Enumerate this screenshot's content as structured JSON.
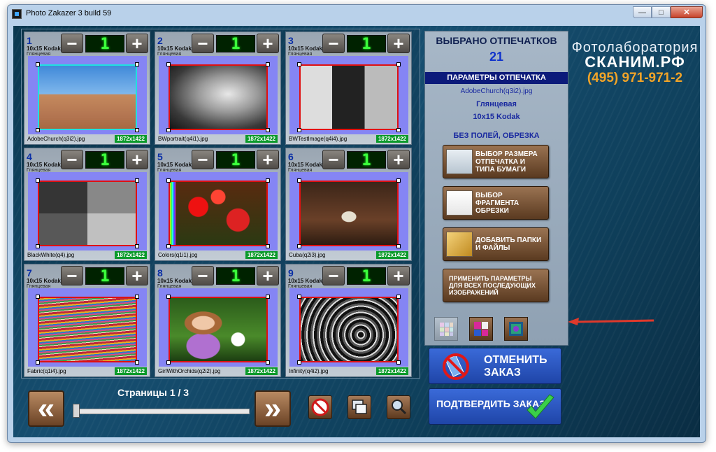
{
  "window": {
    "title": "Photo Zakazer 3 build 59",
    "min": "—",
    "max": "□",
    "close": "✕"
  },
  "brand": {
    "line1": "Фотолаборатория",
    "line2": "СКАНИМ.РФ",
    "phone": "(495) 971-971-2"
  },
  "tiles": [
    {
      "num": "1",
      "size": "10x15 Kodak",
      "paper": "Глянцевая",
      "count": "1",
      "file": "AdobeChurch(q3i2).jpg",
      "res": "1872x1422"
    },
    {
      "num": "2",
      "size": "10x15 Kodak",
      "paper": "Глянцевая",
      "count": "1",
      "file": "BWportrait(q4i1).jpg",
      "res": "1872x1422"
    },
    {
      "num": "3",
      "size": "10x15 Kodak",
      "paper": "Глянцевая",
      "count": "1",
      "file": "BWTestImage(q4i4).jpg",
      "res": "1872x1422"
    },
    {
      "num": "4",
      "size": "10x15 Kodak",
      "paper": "Глянцевая",
      "count": "1",
      "file": "BlackWhite(q4).jpg",
      "res": "1872x1422"
    },
    {
      "num": "5",
      "size": "10x15 Kodak",
      "paper": "Глянцевая",
      "count": "1",
      "file": "Colors(q1i1).jpg",
      "res": "1872x1422"
    },
    {
      "num": "6",
      "size": "10x15 Kodak",
      "paper": "Глянцевая",
      "count": "1",
      "file": "Cuba(q2i3).jpg",
      "res": "1872x1422"
    },
    {
      "num": "7",
      "size": "10x15 Kodak",
      "paper": "Глянцевая",
      "count": "1",
      "file": "Fabric(q1i4).jpg",
      "res": "1872x1422"
    },
    {
      "num": "8",
      "size": "10x15 Kodak",
      "paper": "Глянцевая",
      "count": "1",
      "file": "GirlWithOrchids(q2i2).jpg",
      "res": "1872x1422"
    },
    {
      "num": "9",
      "size": "10x15 Kodak",
      "paper": "Глянцевая",
      "count": "1",
      "file": "Infinity(q4i2).jpg",
      "res": "1872x1422"
    }
  ],
  "controls": {
    "minus": "−",
    "plus": "+"
  },
  "pager": {
    "label": "Страницы 1 / 3",
    "prev": "«",
    "next": "»"
  },
  "side": {
    "title": "ВЫБРАНО ОТПЕЧАТКОВ",
    "count": "21",
    "params_header": "ПАРАМЕТРЫ ОТПЕЧАТКА",
    "file": "AdobeChurch(q3i2).jpg",
    "paper": "Глянцевая",
    "size": "10x15 Kodak",
    "crop_mode": "БЕЗ ПОЛЕЙ, ОБРЕЗКА",
    "btn_size": "ВЫБОР РАЗМЕРА ОТПЕЧАТКА И ТИПА БУМАГИ",
    "btn_crop": "ВЫБОР ФРАГМЕНТА ОБРЕЗКИ",
    "btn_add": "ДОБАВИТЬ ПАПКИ И ФАЙЛЫ",
    "btn_apply": "ПРИМЕНИТЬ ПАРАМЕТРЫ ДЛЯ ВСЕХ ПОСЛЕДУЮЩИХ ИЗОБРАЖЕНИЙ"
  },
  "actions": {
    "cancel": "ОТМЕНИТЬ ЗАКАЗ",
    "confirm": "ПОДТВЕРДИТЬ ЗАКАЗ"
  },
  "colors": {
    "accent_arrow": "#e0392b",
    "counter": "#3cff3c",
    "brand_phone": "#f2a428",
    "thumb_bg": "#8585f4"
  }
}
